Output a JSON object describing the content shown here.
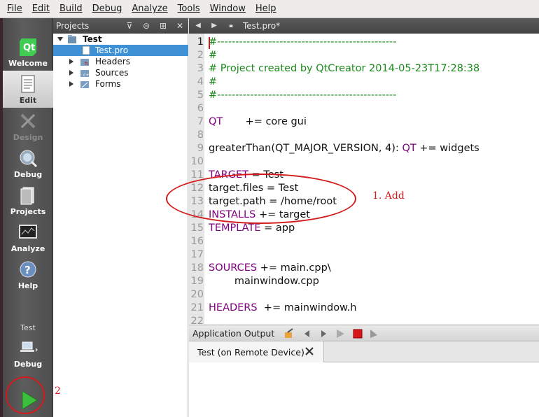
{
  "menu": [
    "File",
    "Edit",
    "Build",
    "Debug",
    "Analyze",
    "Tools",
    "Window",
    "Help"
  ],
  "modes": [
    {
      "label": "Welcome",
      "icon": "qt-logo-icon",
      "state": "normal"
    },
    {
      "label": "Edit",
      "icon": "edit-document-icon",
      "state": "active"
    },
    {
      "label": "Design",
      "icon": "design-tools-icon",
      "state": "disabled"
    },
    {
      "label": "Debug",
      "icon": "debug-bug-icon",
      "state": "normal"
    },
    {
      "label": "Projects",
      "icon": "projects-icon",
      "state": "normal"
    },
    {
      "label": "Analyze",
      "icon": "analyze-monitor-icon",
      "state": "normal"
    },
    {
      "label": "Help",
      "icon": "help-icon",
      "state": "normal"
    }
  ],
  "kit": {
    "project": "Test",
    "config": "Debug"
  },
  "projects_pane": {
    "title": "Projects",
    "tree": [
      {
        "label": "Test",
        "icon": "project-folder-icon",
        "expanded": true
      },
      {
        "label": "Test.pro",
        "icon": "pro-file-icon",
        "selected": true
      },
      {
        "label": "Headers",
        "icon": "headers-folder-icon"
      },
      {
        "label": "Sources",
        "icon": "sources-folder-icon"
      },
      {
        "label": "Forms",
        "icon": "forms-folder-icon"
      }
    ]
  },
  "editor": {
    "file_tab": "Test.pro*",
    "line_numbers": [
      "1",
      "2",
      "3",
      "4",
      "5",
      "6",
      "7",
      "8",
      "9",
      "10",
      "11",
      "12",
      "13",
      "14",
      "15",
      "16",
      "17",
      "18",
      "19",
      "20",
      "21",
      "22"
    ],
    "lines": {
      "l1": "#-------------------------------------------------",
      "l2": "#",
      "l3": "# Project created by QtCreator 2014-05-23T17:28:38",
      "l4": "#",
      "l5": "#-------------------------------------------------",
      "l7_kw": "QT",
      "l7_rest": "       += core gui",
      "l9_a": "greaterThan(QT_MAJOR_VERSION, 4): ",
      "l9_kw": "QT",
      "l9_rest": " += widgets",
      "l11_kw": "TARGET",
      "l11_rest": " = Test",
      "l12": "target.files = Test",
      "l13": "target.path = /home/root",
      "l14_kw": "INSTALLS",
      "l14_rest": " += target",
      "l15_kw": "TEMPLATE",
      "l15_rest": " = app",
      "l18_kw": "SOURCES",
      "l18_rest": " += main.cpp\\",
      "l19": "        mainwindow.cpp",
      "l21_kw": "HEADERS",
      "l21_rest": "  += mainwindow.h"
    }
  },
  "output": {
    "title": "Application Output",
    "tab_label": "Test (on Remote Device)"
  },
  "annotations": {
    "step1": "1. Add",
    "step2": "2"
  },
  "colors": {
    "keyword": "#800080",
    "comment": "#1b8a1b",
    "annotation": "#d31b1b",
    "selection": "#3f91d6"
  }
}
